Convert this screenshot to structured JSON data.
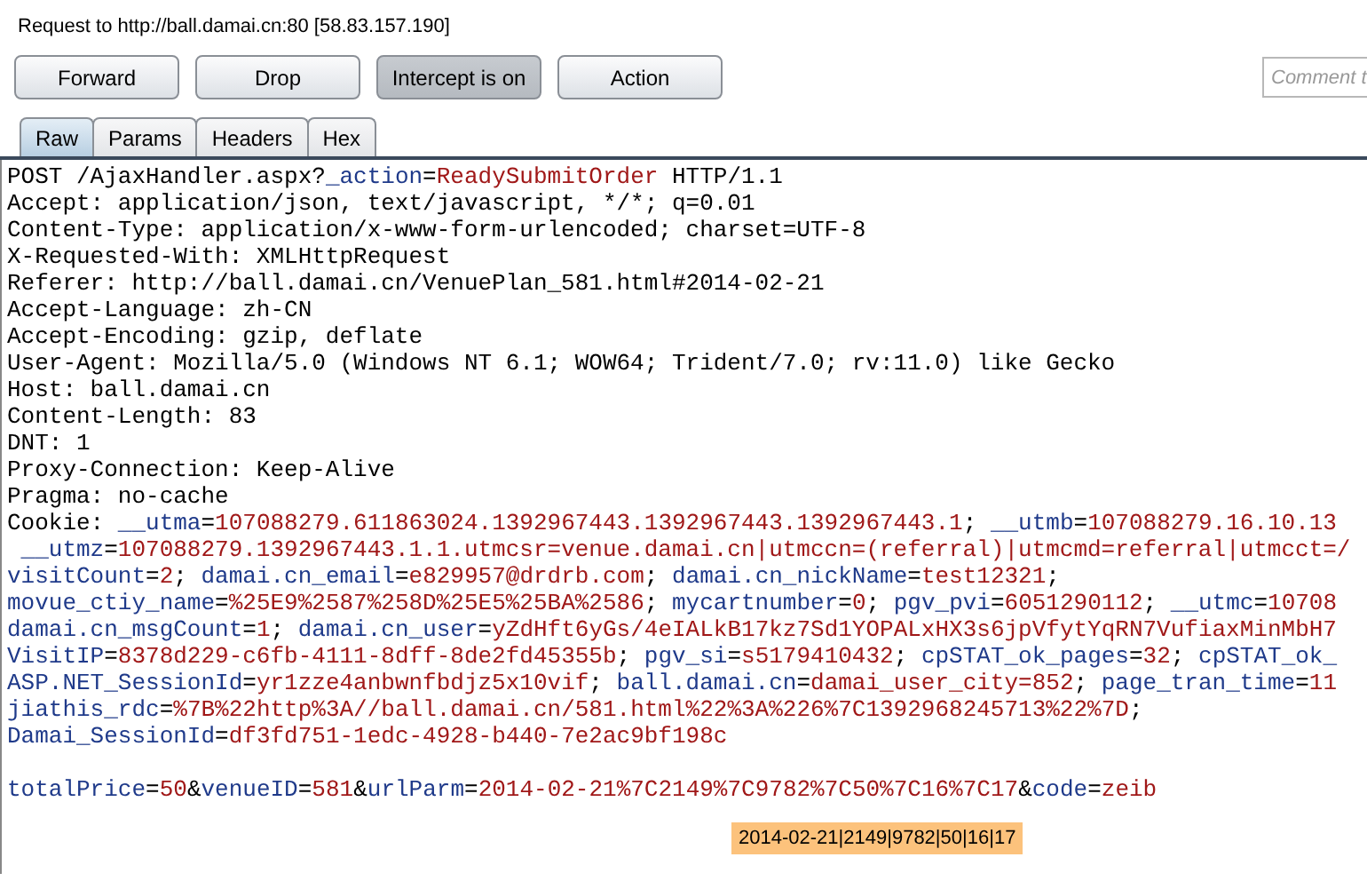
{
  "request_title": "Request to http://ball.damai.cn:80  [58.83.157.190]",
  "buttons": [
    {
      "label": "Forward",
      "pressed": false
    },
    {
      "label": "Drop",
      "pressed": false
    },
    {
      "label": "Intercept is on",
      "pressed": true
    },
    {
      "label": "Action",
      "pressed": false
    }
  ],
  "comment_field": {
    "placeholder": "Comment t"
  },
  "tabs": [
    {
      "label": "Raw",
      "selected": true
    },
    {
      "label": "Params",
      "selected": false
    },
    {
      "label": "Headers",
      "selected": false
    },
    {
      "label": "Hex",
      "selected": false
    }
  ],
  "lines": [
    {
      "kind": "text",
      "segments": [
        {
          "kind": "plain",
          "text": "POST /AjaxHandler.aspx?"
        },
        {
          "kind": "name",
          "text": "_action"
        },
        {
          "kind": "plain",
          "text": "="
        },
        {
          "kind": "value",
          "text": "ReadySubmitOrder"
        },
        {
          "kind": "plain",
          "text": " HTTP/1.1"
        }
      ]
    },
    {
      "kind": "text",
      "segments": [
        {
          "kind": "plain",
          "text": "Accept: application/json, text/javascript, */*; q=0.01"
        }
      ]
    },
    {
      "kind": "text",
      "segments": [
        {
          "kind": "plain",
          "text": "Content-Type: application/x-www-form-urlencoded; charset=UTF-8"
        }
      ]
    },
    {
      "kind": "text",
      "segments": [
        {
          "kind": "plain",
          "text": "X-Requested-With: XMLHttpRequest"
        }
      ]
    },
    {
      "kind": "text",
      "segments": [
        {
          "kind": "plain",
          "text": "Referer: http://ball.damai.cn/VenuePlan_581.html#2014-02-21"
        }
      ]
    },
    {
      "kind": "text",
      "segments": [
        {
          "kind": "plain",
          "text": "Accept-Language: zh-CN"
        }
      ]
    },
    {
      "kind": "text",
      "segments": [
        {
          "kind": "plain",
          "text": "Accept-Encoding: gzip, deflate"
        }
      ]
    },
    {
      "kind": "text",
      "segments": [
        {
          "kind": "plain",
          "text": "User-Agent: Mozilla/5.0 (Windows NT 6.1; WOW64; Trident/7.0; rv:11.0) like Gecko"
        }
      ]
    },
    {
      "kind": "text",
      "segments": [
        {
          "kind": "plain",
          "text": "Host: ball.damai.cn"
        }
      ]
    },
    {
      "kind": "text",
      "segments": [
        {
          "kind": "plain",
          "text": "Content-Length: 83"
        }
      ]
    },
    {
      "kind": "text",
      "segments": [
        {
          "kind": "plain",
          "text": "DNT: 1"
        }
      ]
    },
    {
      "kind": "text",
      "segments": [
        {
          "kind": "plain",
          "text": "Proxy-Connection: Keep-Alive"
        }
      ]
    },
    {
      "kind": "text",
      "segments": [
        {
          "kind": "plain",
          "text": "Pragma: no-cache"
        }
      ]
    },
    {
      "kind": "text",
      "segments": [
        {
          "kind": "plain",
          "text": "Cookie: "
        },
        {
          "kind": "name",
          "text": "__utma"
        },
        {
          "kind": "plain",
          "text": "="
        },
        {
          "kind": "value",
          "text": "107088279.611863024.1392967443.1392967443.1392967443.1"
        },
        {
          "kind": "plain",
          "text": "; "
        },
        {
          "kind": "name",
          "text": "__utmb"
        },
        {
          "kind": "plain",
          "text": "="
        },
        {
          "kind": "value",
          "text": "107088279.16.10.13"
        }
      ]
    },
    {
      "kind": "text",
      "indent": true,
      "segments": [
        {
          "kind": "name",
          "text": "__utmz"
        },
        {
          "kind": "plain",
          "text": "="
        },
        {
          "kind": "value",
          "text": "107088279.1392967443.1.1.utmcsr=venue.damai.cn|utmccn=(referral)|utmcmd=referral|utmcct=/"
        }
      ]
    },
    {
      "kind": "text",
      "segments": [
        {
          "kind": "name",
          "text": "visitCount"
        },
        {
          "kind": "plain",
          "text": "="
        },
        {
          "kind": "value",
          "text": "2"
        },
        {
          "kind": "plain",
          "text": "; "
        },
        {
          "kind": "name",
          "text": "damai.cn_email"
        },
        {
          "kind": "plain",
          "text": "="
        },
        {
          "kind": "value",
          "text": "e829957@drdrb.com"
        },
        {
          "kind": "plain",
          "text": "; "
        },
        {
          "kind": "name",
          "text": "damai.cn_nickName"
        },
        {
          "kind": "plain",
          "text": "="
        },
        {
          "kind": "value",
          "text": "test12321"
        },
        {
          "kind": "plain",
          "text": ";"
        }
      ]
    },
    {
      "kind": "text",
      "segments": [
        {
          "kind": "name",
          "text": "movue_ctiy_name"
        },
        {
          "kind": "plain",
          "text": "="
        },
        {
          "kind": "value",
          "text": "%25E9%2587%258D%25E5%25BA%2586"
        },
        {
          "kind": "plain",
          "text": "; "
        },
        {
          "kind": "name",
          "text": "mycartnumber"
        },
        {
          "kind": "plain",
          "text": "="
        },
        {
          "kind": "value",
          "text": "0"
        },
        {
          "kind": "plain",
          "text": "; "
        },
        {
          "kind": "name",
          "text": "pgv_pvi"
        },
        {
          "kind": "plain",
          "text": "="
        },
        {
          "kind": "value",
          "text": "6051290112"
        },
        {
          "kind": "plain",
          "text": "; "
        },
        {
          "kind": "name",
          "text": "__utmc"
        },
        {
          "kind": "plain",
          "text": "="
        },
        {
          "kind": "value",
          "text": "10708"
        }
      ]
    },
    {
      "kind": "text",
      "segments": [
        {
          "kind": "name",
          "text": "damai.cn_msgCount"
        },
        {
          "kind": "plain",
          "text": "="
        },
        {
          "kind": "value",
          "text": "1"
        },
        {
          "kind": "plain",
          "text": "; "
        },
        {
          "kind": "name",
          "text": "damai.cn_user"
        },
        {
          "kind": "plain",
          "text": "="
        },
        {
          "kind": "value",
          "text": "yZdHft6yGs/4eIALkB17kz7Sd1YOPALxHX3s6jpVfytYqRN7VufiaxMinMbH7"
        }
      ]
    },
    {
      "kind": "text",
      "segments": [
        {
          "kind": "name",
          "text": "VisitIP"
        },
        {
          "kind": "plain",
          "text": "="
        },
        {
          "kind": "value",
          "text": "8378d229-c6fb-4111-8dff-8de2fd45355b"
        },
        {
          "kind": "plain",
          "text": "; "
        },
        {
          "kind": "name",
          "text": "pgv_si"
        },
        {
          "kind": "plain",
          "text": "="
        },
        {
          "kind": "value",
          "text": "s5179410432"
        },
        {
          "kind": "plain",
          "text": "; "
        },
        {
          "kind": "name",
          "text": "cpSTAT_ok_pages"
        },
        {
          "kind": "plain",
          "text": "="
        },
        {
          "kind": "value",
          "text": "32"
        },
        {
          "kind": "plain",
          "text": "; "
        },
        {
          "kind": "name",
          "text": "cpSTAT_ok_"
        }
      ]
    },
    {
      "kind": "text",
      "segments": [
        {
          "kind": "name",
          "text": "ASP.NET_SessionId"
        },
        {
          "kind": "plain",
          "text": "="
        },
        {
          "kind": "value",
          "text": "yr1zze4anbwnfbdjz5x10vif"
        },
        {
          "kind": "plain",
          "text": "; "
        },
        {
          "kind": "name",
          "text": "ball.damai.cn"
        },
        {
          "kind": "plain",
          "text": "="
        },
        {
          "kind": "value",
          "text": "damai_user_city=852"
        },
        {
          "kind": "plain",
          "text": "; "
        },
        {
          "kind": "name",
          "text": "page_tran_time"
        },
        {
          "kind": "plain",
          "text": "="
        },
        {
          "kind": "value",
          "text": "11"
        }
      ]
    },
    {
      "kind": "text",
      "segments": [
        {
          "kind": "name",
          "text": "jiathis_rdc"
        },
        {
          "kind": "plain",
          "text": "="
        },
        {
          "kind": "value",
          "text": "%7B%22http%3A//ball.damai.cn/581.html%22%3A%226%7C1392968245713%22%7D"
        },
        {
          "kind": "plain",
          "text": ";"
        }
      ]
    },
    {
      "kind": "text",
      "segments": [
        {
          "kind": "name",
          "text": "Damai_SessionId"
        },
        {
          "kind": "plain",
          "text": "="
        },
        {
          "kind": "value",
          "text": "df3fd751-1edc-4928-b440-7e2ac9bf198c"
        }
      ]
    },
    {
      "kind": "blank"
    },
    {
      "kind": "text",
      "segments": [
        {
          "kind": "name",
          "text": "totalPrice"
        },
        {
          "kind": "plain",
          "text": "="
        },
        {
          "kind": "value",
          "text": "50"
        },
        {
          "kind": "plain",
          "text": "&"
        },
        {
          "kind": "name",
          "text": "venueID"
        },
        {
          "kind": "plain",
          "text": "="
        },
        {
          "kind": "value",
          "text": "581"
        },
        {
          "kind": "plain",
          "text": "&"
        },
        {
          "kind": "name",
          "text": "urlParm"
        },
        {
          "kind": "plain",
          "text": "="
        },
        {
          "kind": "value",
          "text": "2014-02-21%7C2149%7C9782%7C50%7C16%7C17"
        },
        {
          "kind": "plain",
          "text": "&"
        },
        {
          "kind": "name",
          "text": "code"
        },
        {
          "kind": "plain",
          "text": "="
        },
        {
          "kind": "value",
          "text": "zeib"
        }
      ]
    }
  ],
  "decoded_tooltip": "2014-02-21|2149|9782|50|16|17"
}
